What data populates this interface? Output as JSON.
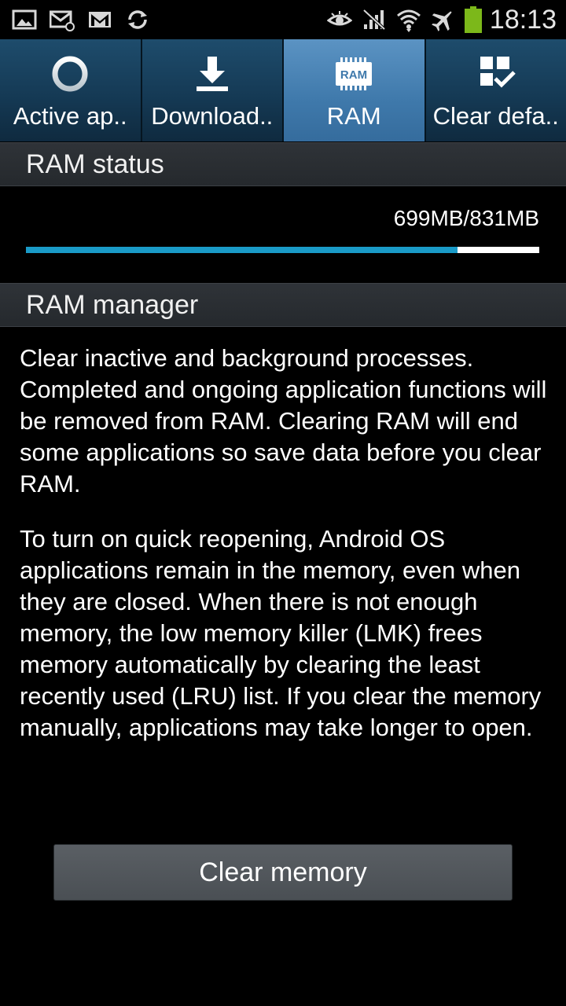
{
  "status_bar": {
    "time": "18:13",
    "left_icons": [
      "gallery-icon",
      "email-icon",
      "gmail-icon",
      "sync-icon"
    ],
    "right_icons": [
      "smart-stay-eye-icon",
      "no-signal-icon",
      "wifi-icon",
      "airplane-mode-icon",
      "battery-icon"
    ],
    "battery_color": "#7cb81a"
  },
  "tabs": [
    {
      "label": "Active ap..",
      "icon": "active-apps-ring-icon",
      "active": false
    },
    {
      "label": "Download..",
      "icon": "download-icon",
      "active": false
    },
    {
      "label": "RAM",
      "icon": "ram-chip-icon",
      "icon_text": "RAM",
      "active": true
    },
    {
      "label": "Clear defa..",
      "icon": "clear-defaults-icon",
      "active": false
    }
  ],
  "ram_status": {
    "header": "RAM status",
    "readout": "699MB/831MB",
    "used_mb": 699,
    "total_mb": 831,
    "bar_color": "#1a9bc8"
  },
  "ram_manager": {
    "header": "RAM manager",
    "paragraph1": "Clear inactive and background processes. Completed and ongoing application functions will be removed from RAM. Clearing RAM will end some applications so save data before you clear RAM.",
    "paragraph2": "To turn on quick reopening, Android OS applications remain in the memory, even when they are closed. When there is not enough memory, the low memory killer (LMK) frees memory automatically by clearing the least recently used (LRU) list. If you clear the memory manually, applications may take longer to open."
  },
  "actions": {
    "clear_memory_label": "Clear memory"
  },
  "colors": {
    "active_tab": "#4a85b8",
    "inactive_tab": "#163a55",
    "section_header": "#2b2f33"
  }
}
